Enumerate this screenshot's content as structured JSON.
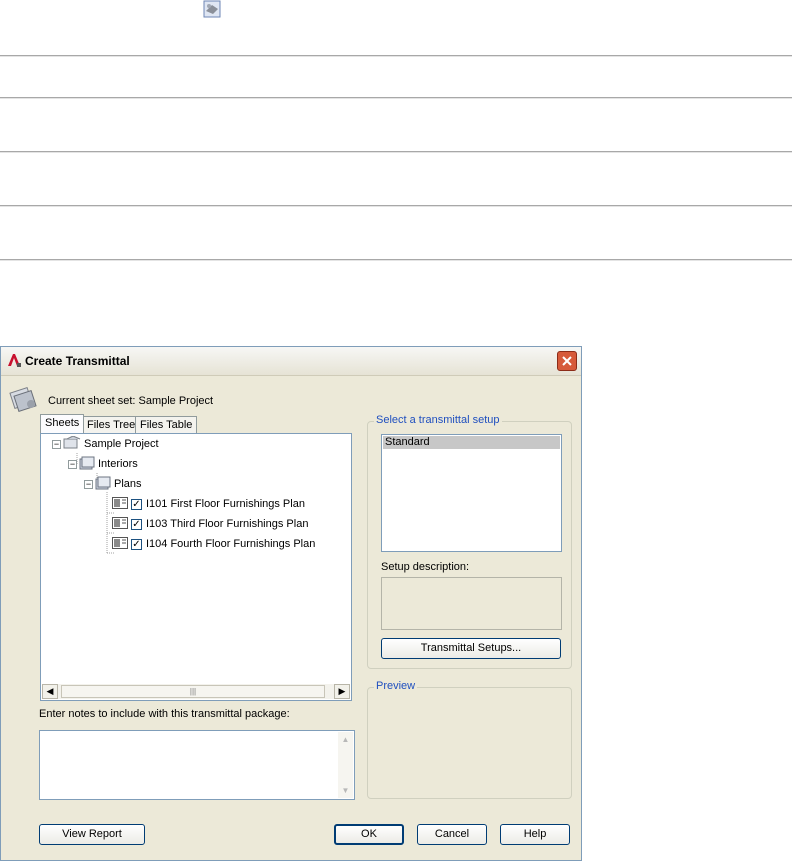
{
  "dialog": {
    "title": "Create Transmittal",
    "current_sheet_set": "Current sheet set: Sample Project"
  },
  "tabs": [
    {
      "label": "Sheets",
      "active": true
    },
    {
      "label": "Files Tree",
      "active": false
    },
    {
      "label": "Files Table",
      "active": false
    }
  ],
  "tree": {
    "root": "Sample Project",
    "subset": "Interiors",
    "subsubset": "Plans",
    "sheets": [
      {
        "label": "I101 First Floor Furnishings Plan",
        "checked": true
      },
      {
        "label": "I103 Third Floor Furnishings Plan",
        "checked": true
      },
      {
        "label": "I104 Fourth Floor Furnishings Plan",
        "checked": true
      }
    ]
  },
  "notes": {
    "label": "Enter notes to include with this transmittal package:",
    "value": ""
  },
  "setup": {
    "group_label": "Select a transmittal setup",
    "items": [
      "Standard"
    ],
    "selected": "Standard",
    "description_label": "Setup description:",
    "description_value": "",
    "setups_button": "Transmittal Setups..."
  },
  "preview": {
    "group_label": "Preview"
  },
  "buttons": {
    "view_report": "View Report",
    "ok": "OK",
    "cancel": "Cancel",
    "help": "Help"
  },
  "colors": {
    "accent": "#1f4fbf",
    "selection": "#c7c7c7",
    "dialog_bg": "#ece9d8"
  }
}
